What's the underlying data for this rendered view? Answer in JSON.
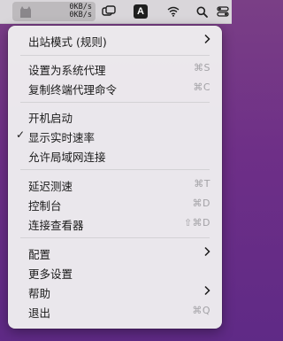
{
  "menubar": {
    "upload_speed": "0KB/s",
    "download_speed": "0KB/s",
    "icons": [
      "cat-icon",
      "window-switcher-icon",
      "input-method-icon",
      "wifi-icon",
      "search-icon",
      "control-center-icon"
    ],
    "input_method_letter": "A"
  },
  "menu": {
    "outbound_mode": "出站模式 (规则)",
    "set_system_proxy": "设置为系统代理",
    "set_system_proxy_shortcut": "⌘S",
    "copy_terminal_proxy": "复制终端代理命令",
    "copy_terminal_proxy_shortcut": "⌘C",
    "launch_at_login": "开机启动",
    "show_realtime_speed": "显示实时速率",
    "show_realtime_speed_checked": true,
    "allow_lan": "允许局域网连接",
    "latency_test": "延迟测速",
    "latency_test_shortcut": "⌘T",
    "dashboard": "控制台",
    "dashboard_shortcut": "⌘D",
    "connection_viewer": "连接查看器",
    "connection_viewer_shortcut": "⇧⌘D",
    "config": "配置",
    "more_settings": "更多设置",
    "help": "帮助",
    "quit": "退出",
    "quit_shortcut": "⌘Q",
    "check_mark": "✓"
  },
  "colors": {
    "desktop": "#6e2f87",
    "menubar": "#d9d6da",
    "menu_bg": "#eeedf0",
    "shortcut_text": "#a3a2a6"
  }
}
